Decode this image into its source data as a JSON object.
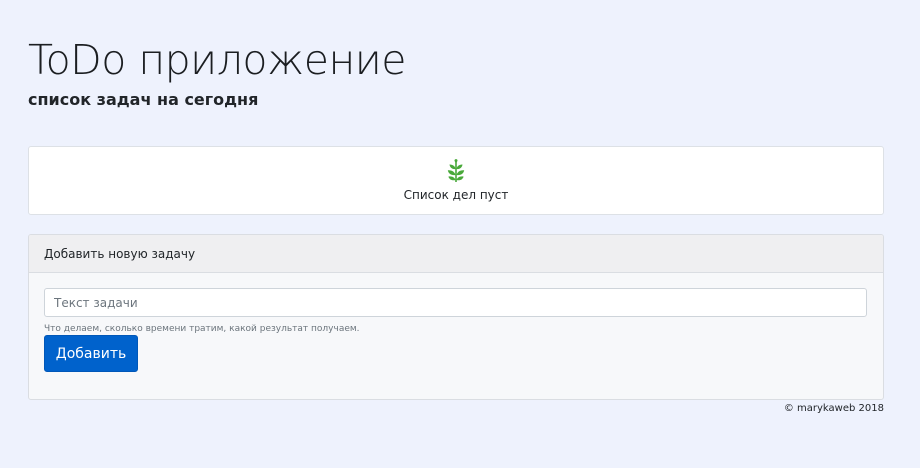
{
  "header": {
    "title": "ToDo приложение",
    "subtitle": "список задач на сегодня"
  },
  "task_list": {
    "empty_icon": "leaf-icon",
    "empty_message": "Список дел пуст"
  },
  "add_task": {
    "header": "Добавить новую задачу",
    "input_value": "",
    "input_placeholder": "Текст задачи",
    "help_text": "Что делаем, сколько времени тратим, какой результат получаем.",
    "button_label": "Добавить"
  },
  "footer": {
    "copyright": "© marykaweb 2018"
  },
  "colors": {
    "page_background": "#eef2fd",
    "primary_button": "#0062cc",
    "leaf_icon": "#49a93a"
  }
}
